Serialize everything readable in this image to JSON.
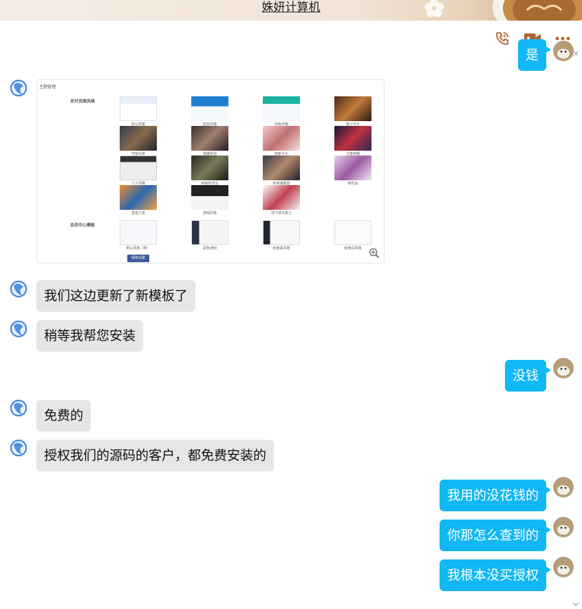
{
  "window": {
    "title": "姝妍计算机"
  },
  "toolbar": {
    "call_icon": "phone-icon",
    "video_icon": "video-call-icon",
    "more_icon": "more-icon"
  },
  "messages": {
    "m0": {
      "text": "是",
      "side": "right"
    },
    "m1": {
      "type": "image",
      "side": "left"
    },
    "m2": {
      "text": "我们这边更新了新模板了",
      "side": "left"
    },
    "m3": {
      "text": "稍等我帮您安装",
      "side": "left"
    },
    "m4": {
      "text": "没钱",
      "side": "right"
    },
    "m5": {
      "text": "免费的",
      "side": "left"
    },
    "m6": {
      "text": "授权我们的源码的客户，都免费安装的",
      "side": "left"
    },
    "m7": {
      "text": "我用的没花钱的",
      "side": "right"
    },
    "m8": {
      "text": "你那怎么查到的",
      "side": "right"
    },
    "m9": {
      "text": "我根本没买授权",
      "side": "right"
    }
  },
  "screenshot": {
    "header": "主题管理",
    "section_pay": "支付页面风格",
    "section_member": "会员中心模板",
    "save_label": "保存设置",
    "captions": [
      "默认风格",
      "蓝色风格",
      "绿色风格",
      "格斗卡片",
      "守望先锋",
      "英雄联盟",
      "暗紫卡片",
      "王者荣耀",
      "个人风格",
      "新绝地求生",
      "新英雄联盟",
      "樱花岛",
      "莫金之夜",
      "游戏风格",
      "地下城与勇士",
      "默认风格（新）",
      "黑色通知",
      "经典黑风格",
      "经典白风格"
    ]
  },
  "colors": {
    "bubble_self": "#12b7f5",
    "bubble_other": "#e6e6e6",
    "icon": "#b5602f"
  }
}
